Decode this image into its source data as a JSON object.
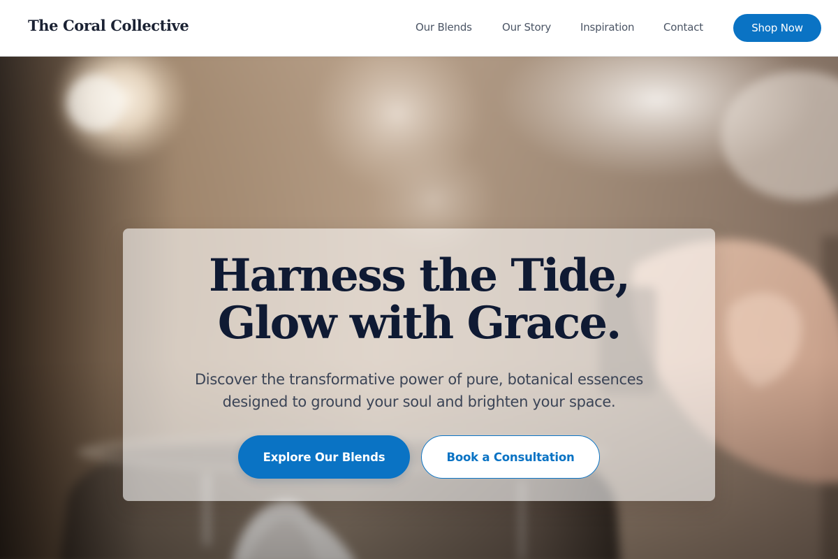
{
  "header": {
    "brand": "The Coral Collective",
    "nav": [
      {
        "label": "Our Blends"
      },
      {
        "label": "Our Story"
      },
      {
        "label": "Inspiration"
      },
      {
        "label": "Contact"
      }
    ],
    "cta_label": "Shop Now"
  },
  "hero": {
    "title_line_1": "Harness the Tide,",
    "title_line_2": "Glow with Grace.",
    "subtitle": "Discover the transformative power of pure, botanical essences designed to ground your soul and brighten your space.",
    "primary_button": "Explore Our Blends",
    "secondary_button": "Book a Consultation",
    "background_image": "blurred-aroma-diffuser-photo"
  },
  "colors": {
    "accent": "#0a73c4",
    "heading": "#0f1a33",
    "body_text": "#3b4456",
    "nav_text": "#4b5565",
    "header_bg": "#ffffff"
  }
}
